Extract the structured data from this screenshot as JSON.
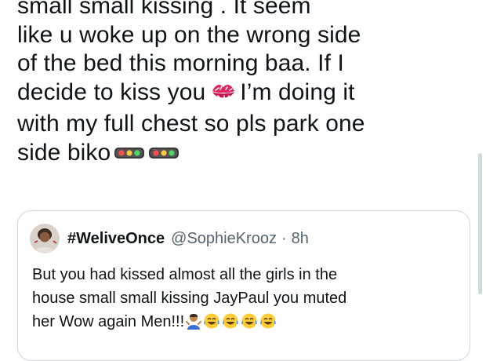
{
  "tweet": {
    "lines": [
      "small small kissing . It seem",
      "like u woke up on the wrong side",
      "of the bed this morning baa. If I",
      "decide to kiss you",
      "I’m doing it",
      "with my full chest so pls park one",
      "side biko"
    ],
    "emojis": [
      "kiss-mark-icon",
      "traffic-light-icon",
      "traffic-light-icon"
    ]
  },
  "quote": {
    "display_name": "#WeliveOnce",
    "handle": "@SophieKrooz",
    "separator": "·",
    "time": "8h",
    "lines": [
      "But you had kissed almost all the girls in the",
      "house small small kissing JayPaul you muted",
      "her Wow again Men!!!"
    ],
    "emojis": [
      "man-shrugging-icon",
      "tears-of-joy-icon",
      "tears-of-joy-icon",
      "tears-of-joy-icon",
      "tears-of-joy-icon"
    ]
  },
  "colors": {
    "text": "#0f1419",
    "secondary": "#536471",
    "border": "#cfd9de",
    "kiss": "#e0245e"
  }
}
